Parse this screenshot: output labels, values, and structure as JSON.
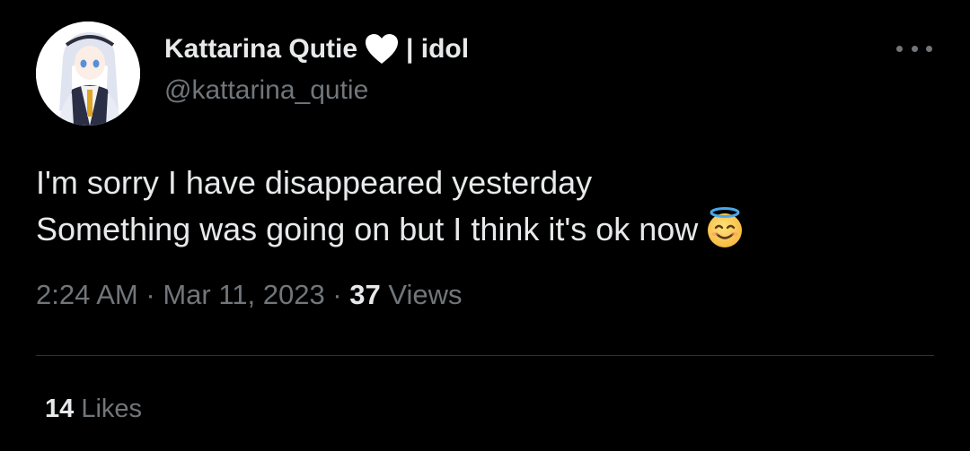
{
  "author": {
    "display_name": "Kattarina Qutie",
    "name_suffix": "| idol",
    "handle": "@kattarina_qutie",
    "heart_icon": "white-heart-icon"
  },
  "tweet": {
    "lines": [
      "I'm sorry I have disappeared yesterday",
      "Something was going on but I think it's ok now"
    ],
    "emoji": "smiling-face-with-halo-icon"
  },
  "meta": {
    "time": "2:24 AM",
    "separator1": " · ",
    "date": "Mar 11, 2023",
    "separator2": " · ",
    "views_count": "37",
    "views_label": "Views"
  },
  "stats": {
    "likes_count": "14",
    "likes_label": "Likes"
  },
  "colors": {
    "background": "#000000",
    "primary_text": "#e7e9ea",
    "secondary_text": "#71767b",
    "divider": "#2f3336"
  }
}
